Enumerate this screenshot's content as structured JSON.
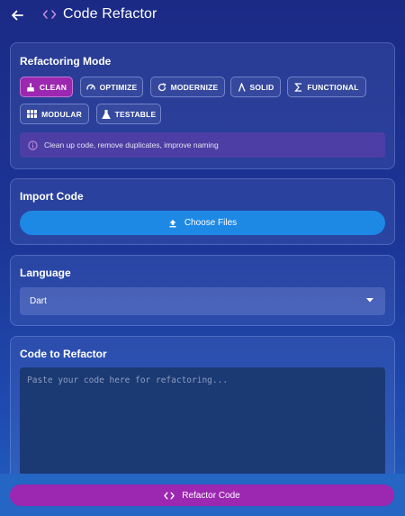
{
  "appbar": {
    "title": "Code Refactor",
    "back_icon": "arrow-left-icon",
    "title_icon": "code-brackets-icon",
    "accent": "#c48bde"
  },
  "refactoring_mode": {
    "title": "Refactoring Mode",
    "modes": [
      {
        "label": "CLEAN",
        "icon": "broom-icon",
        "active": true
      },
      {
        "label": "OPTIMIZE",
        "icon": "speedometer-icon",
        "active": false
      },
      {
        "label": "MODERNIZE",
        "icon": "refresh-icon",
        "active": false
      },
      {
        "label": "SOLID",
        "icon": "lambda-icon",
        "active": false
      },
      {
        "label": "FUNCTIONAL",
        "icon": "sigma-icon",
        "active": false
      },
      {
        "label": "MODULAR",
        "icon": "grid-icon",
        "active": false
      },
      {
        "label": "TESTABLE",
        "icon": "flask-icon",
        "active": false
      }
    ],
    "description": "Clean up code, remove duplicates, improve naming",
    "active_color": "#9c27b0"
  },
  "import_code": {
    "title": "Import Code",
    "button_label": "Choose Files",
    "button_color": "#1e88e5"
  },
  "language": {
    "title": "Language",
    "selected": "Dart"
  },
  "code_input": {
    "title": "Code to Refactor",
    "placeholder": "Paste your code here for refactoring..."
  },
  "footer": {
    "button_label": "Refactor Code",
    "button_color": "#9c27b0"
  }
}
